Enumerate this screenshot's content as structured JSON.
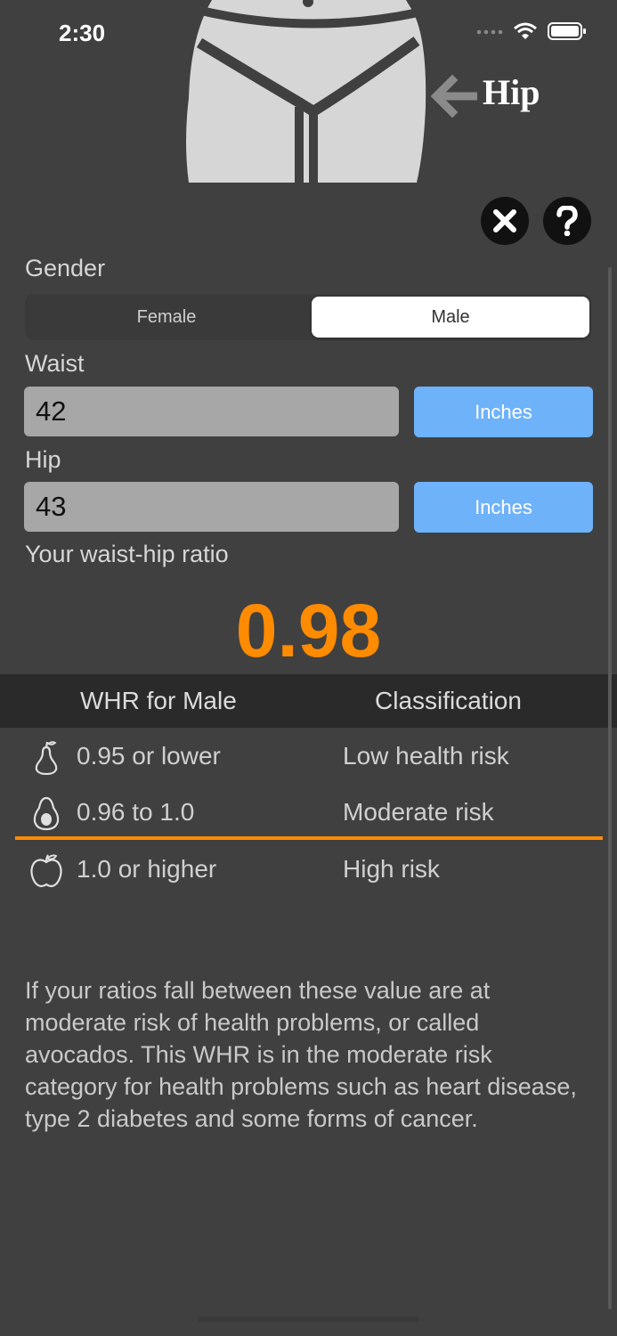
{
  "status_bar": {
    "time": "2:30"
  },
  "hero": {
    "pointer_label": "Hip"
  },
  "gender": {
    "label": "Gender",
    "options": [
      "Female",
      "Male"
    ],
    "selected": "Male"
  },
  "waist": {
    "label": "Waist",
    "value": "42",
    "unit": "Inches"
  },
  "hip": {
    "label": "Hip",
    "value": "43",
    "unit": "Inches"
  },
  "result": {
    "label": "Your waist-hip ratio",
    "value": "0.98"
  },
  "table": {
    "headers": [
      "WHR for Male",
      "Classification"
    ],
    "rows": [
      {
        "icon": "pear-icon",
        "range": "0.95 or lower",
        "classification": "Low health risk"
      },
      {
        "icon": "avocado-icon",
        "range": "0.96 to 1.0",
        "classification": "Moderate risk"
      },
      {
        "icon": "apple-icon",
        "range": "1.0 or higher",
        "classification": "High risk"
      }
    ],
    "highlighted_row": 1
  },
  "description": "If your ratios fall between these value are at moderate risk of health problems, or called avocados. This WHR is in the moderate risk category for health problems such as heart disease, type 2 diabetes and some forms of cancer.",
  "colors": {
    "background": "#404040",
    "accent_orange": "#ff8b00",
    "unit_button_blue": "#6eb2fa",
    "input_gray": "#a7a7a7"
  }
}
